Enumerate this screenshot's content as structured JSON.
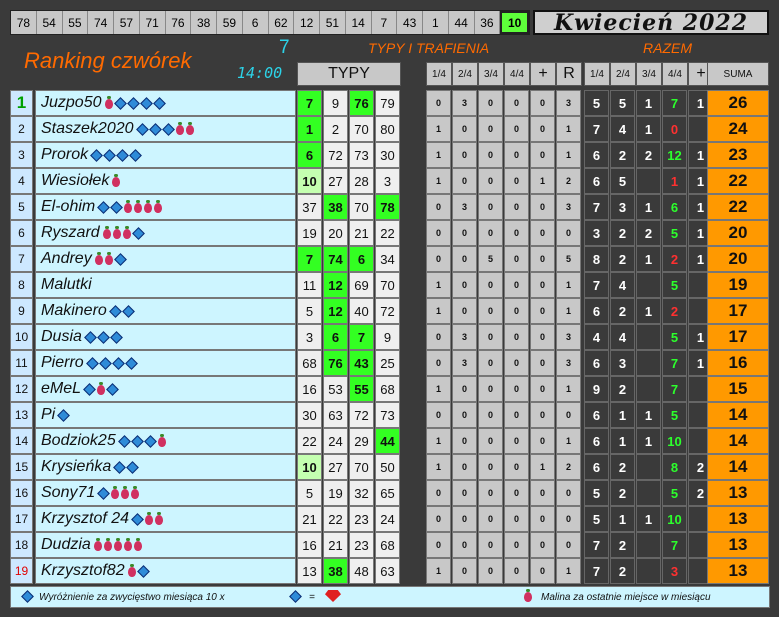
{
  "top_numbers": [
    "78",
    "54",
    "55",
    "74",
    "57",
    "71",
    "76",
    "38",
    "59",
    "6",
    "62",
    "12",
    "51",
    "14",
    "7",
    "43",
    "1",
    "44",
    "36",
    "10"
  ],
  "highlight_number": "10",
  "month_title": "Kwiecień 2022",
  "title": "Ranking czwórek",
  "round": "7",
  "time": "14:00",
  "typy_trafienia": "TYPY I TRAFIENIA",
  "razem": "RAZEM",
  "headers": {
    "typy": "TYPY",
    "score_cols": [
      "1/4",
      "2/4",
      "3/4",
      "4/4",
      "+",
      "R"
    ],
    "razem_cols": [
      "1/4",
      "2/4",
      "3/4",
      "4/4",
      "+"
    ],
    "suma": "SUMA"
  },
  "rows": [
    {
      "rank": "1",
      "name": "Juzpo50",
      "badges": [
        "r",
        "d",
        "d",
        "d",
        "d"
      ],
      "typy": [
        {
          "v": "7",
          "h": 1
        },
        {
          "v": "9",
          "h": 0
        },
        {
          "v": "76",
          "h": 1
        },
        {
          "v": "79",
          "h": 0
        }
      ],
      "sc": [
        "0",
        "3",
        "0",
        "0",
        "0",
        "3"
      ],
      "rz": [
        {
          "v": "5"
        },
        {
          "v": "5"
        },
        {
          "v": "1"
        },
        {
          "v": "7",
          "c": "g"
        },
        {
          "v": "1"
        }
      ],
      "suma": "26"
    },
    {
      "rank": "2",
      "name": "Staszek2020",
      "badges": [
        "d",
        "d",
        "d",
        "r",
        "r"
      ],
      "typy": [
        {
          "v": "1",
          "h": 1
        },
        {
          "v": "2",
          "h": 0
        },
        {
          "v": "70",
          "h": 0
        },
        {
          "v": "80",
          "h": 0
        }
      ],
      "sc": [
        "1",
        "0",
        "0",
        "0",
        "0",
        "1"
      ],
      "rz": [
        {
          "v": "7"
        },
        {
          "v": "4"
        },
        {
          "v": "1"
        },
        {
          "v": "0",
          "c": "r"
        },
        {
          "v": ""
        }
      ],
      "suma": "24"
    },
    {
      "rank": "3",
      "name": "Prorok",
      "badges": [
        "d",
        "d",
        "d",
        "d"
      ],
      "typy": [
        {
          "v": "6",
          "h": 1
        },
        {
          "v": "72",
          "h": 0
        },
        {
          "v": "73",
          "h": 0
        },
        {
          "v": "30",
          "h": 0
        }
      ],
      "sc": [
        "1",
        "0",
        "0",
        "0",
        "0",
        "1"
      ],
      "rz": [
        {
          "v": "6"
        },
        {
          "v": "2"
        },
        {
          "v": "2"
        },
        {
          "v": "12",
          "c": "g"
        },
        {
          "v": "1"
        }
      ],
      "suma": "23"
    },
    {
      "rank": "4",
      "name": "Wiesiołek",
      "badges": [
        "r"
      ],
      "typy": [
        {
          "v": "10",
          "h": 2
        },
        {
          "v": "27",
          "h": 0
        },
        {
          "v": "28",
          "h": 0
        },
        {
          "v": "3",
          "h": 0
        }
      ],
      "sc": [
        "1",
        "0",
        "0",
        "0",
        "1",
        "2"
      ],
      "rz": [
        {
          "v": "6"
        },
        {
          "v": "5"
        },
        {
          "v": ""
        },
        {
          "v": "1",
          "c": "r"
        },
        {
          "v": "1"
        }
      ],
      "suma": "22"
    },
    {
      "rank": "5",
      "name": "El-ohim",
      "badges": [
        "d",
        "d",
        "r",
        "r",
        "r",
        "r"
      ],
      "typy": [
        {
          "v": "37",
          "h": 0
        },
        {
          "v": "38",
          "h": 1
        },
        {
          "v": "70",
          "h": 0
        },
        {
          "v": "78",
          "h": 1
        }
      ],
      "sc": [
        "0",
        "3",
        "0",
        "0",
        "0",
        "3"
      ],
      "rz": [
        {
          "v": "7"
        },
        {
          "v": "3"
        },
        {
          "v": "1"
        },
        {
          "v": "6",
          "c": "g"
        },
        {
          "v": "1"
        }
      ],
      "suma": "22"
    },
    {
      "rank": "6",
      "name": "Ryszard",
      "badges": [
        "r",
        "r",
        "r",
        "d"
      ],
      "typy": [
        {
          "v": "19",
          "h": 0
        },
        {
          "v": "20",
          "h": 0
        },
        {
          "v": "21",
          "h": 0
        },
        {
          "v": "22",
          "h": 0
        }
      ],
      "sc": [
        "0",
        "0",
        "0",
        "0",
        "0",
        "0"
      ],
      "rz": [
        {
          "v": "3"
        },
        {
          "v": "2"
        },
        {
          "v": "2"
        },
        {
          "v": "5",
          "c": "g"
        },
        {
          "v": "1"
        }
      ],
      "suma": "20"
    },
    {
      "rank": "7",
      "name": "Andrey",
      "badges": [
        "r",
        "r",
        "d"
      ],
      "typy": [
        {
          "v": "7",
          "h": 1
        },
        {
          "v": "74",
          "h": 1
        },
        {
          "v": "6",
          "h": 1
        },
        {
          "v": "34",
          "h": 0
        }
      ],
      "sc": [
        "0",
        "0",
        "5",
        "0",
        "0",
        "5"
      ],
      "rz": [
        {
          "v": "8"
        },
        {
          "v": "2"
        },
        {
          "v": "1"
        },
        {
          "v": "2",
          "c": "r"
        },
        {
          "v": "1"
        }
      ],
      "suma": "20"
    },
    {
      "rank": "8",
      "name": "Malutki",
      "badges": [],
      "typy": [
        {
          "v": "11",
          "h": 0
        },
        {
          "v": "12",
          "h": 1
        },
        {
          "v": "69",
          "h": 0
        },
        {
          "v": "70",
          "h": 0
        }
      ],
      "sc": [
        "1",
        "0",
        "0",
        "0",
        "0",
        "1"
      ],
      "rz": [
        {
          "v": "7"
        },
        {
          "v": "4"
        },
        {
          "v": ""
        },
        {
          "v": "5",
          "c": "g"
        },
        {
          "v": ""
        }
      ],
      "suma": "19"
    },
    {
      "rank": "9",
      "name": "Makinero",
      "badges": [
        "d",
        "d"
      ],
      "typy": [
        {
          "v": "5",
          "h": 0
        },
        {
          "v": "12",
          "h": 1
        },
        {
          "v": "40",
          "h": 0
        },
        {
          "v": "72",
          "h": 0
        }
      ],
      "sc": [
        "1",
        "0",
        "0",
        "0",
        "0",
        "1"
      ],
      "rz": [
        {
          "v": "6"
        },
        {
          "v": "2"
        },
        {
          "v": "1"
        },
        {
          "v": "2",
          "c": "r"
        },
        {
          "v": ""
        }
      ],
      "suma": "17"
    },
    {
      "rank": "10",
      "name": "Dusia",
      "badges": [
        "d",
        "d",
        "d"
      ],
      "typy": [
        {
          "v": "3",
          "h": 0
        },
        {
          "v": "6",
          "h": 1
        },
        {
          "v": "7",
          "h": 1
        },
        {
          "v": "9",
          "h": 0
        }
      ],
      "sc": [
        "0",
        "3",
        "0",
        "0",
        "0",
        "3"
      ],
      "rz": [
        {
          "v": "4"
        },
        {
          "v": "4"
        },
        {
          "v": ""
        },
        {
          "v": "5",
          "c": "g"
        },
        {
          "v": "1"
        }
      ],
      "suma": "17"
    },
    {
      "rank": "11",
      "name": "Pierro",
      "badges": [
        "d",
        "d",
        "d",
        "d"
      ],
      "typy": [
        {
          "v": "68",
          "h": 0
        },
        {
          "v": "76",
          "h": 1
        },
        {
          "v": "43",
          "h": 1
        },
        {
          "v": "25",
          "h": 0
        }
      ],
      "sc": [
        "0",
        "3",
        "0",
        "0",
        "0",
        "3"
      ],
      "rz": [
        {
          "v": "6"
        },
        {
          "v": "3"
        },
        {
          "v": ""
        },
        {
          "v": "7",
          "c": "g"
        },
        {
          "v": "1"
        }
      ],
      "suma": "16"
    },
    {
      "rank": "12",
      "name": "eMeL",
      "badges": [
        "d",
        "r",
        "d"
      ],
      "typy": [
        {
          "v": "16",
          "h": 0
        },
        {
          "v": "53",
          "h": 0
        },
        {
          "v": "55",
          "h": 1
        },
        {
          "v": "68",
          "h": 0
        }
      ],
      "sc": [
        "1",
        "0",
        "0",
        "0",
        "0",
        "1"
      ],
      "rz": [
        {
          "v": "9"
        },
        {
          "v": "2"
        },
        {
          "v": ""
        },
        {
          "v": "7",
          "c": "g"
        },
        {
          "v": ""
        }
      ],
      "suma": "15"
    },
    {
      "rank": "13",
      "name": "Pi",
      "badges": [
        "d"
      ],
      "typy": [
        {
          "v": "30",
          "h": 0
        },
        {
          "v": "63",
          "h": 0
        },
        {
          "v": "72",
          "h": 0
        },
        {
          "v": "73",
          "h": 0
        }
      ],
      "sc": [
        "0",
        "0",
        "0",
        "0",
        "0",
        "0"
      ],
      "rz": [
        {
          "v": "6"
        },
        {
          "v": "1"
        },
        {
          "v": "1"
        },
        {
          "v": "5",
          "c": "g"
        },
        {
          "v": ""
        }
      ],
      "suma": "14"
    },
    {
      "rank": "14",
      "name": "Bodziok25",
      "badges": [
        "d",
        "d",
        "d",
        "r"
      ],
      "typy": [
        {
          "v": "22",
          "h": 0
        },
        {
          "v": "24",
          "h": 0
        },
        {
          "v": "29",
          "h": 0
        },
        {
          "v": "44",
          "h": 1
        }
      ],
      "sc": [
        "1",
        "0",
        "0",
        "0",
        "0",
        "1"
      ],
      "rz": [
        {
          "v": "6"
        },
        {
          "v": "1"
        },
        {
          "v": "1"
        },
        {
          "v": "10",
          "c": "g"
        },
        {
          "v": ""
        }
      ],
      "suma": "14"
    },
    {
      "rank": "15",
      "name": "Krysieńka",
      "badges": [
        "d",
        "d"
      ],
      "typy": [
        {
          "v": "10",
          "h": 2
        },
        {
          "v": "27",
          "h": 0
        },
        {
          "v": "70",
          "h": 0
        },
        {
          "v": "50",
          "h": 0
        }
      ],
      "sc": [
        "1",
        "0",
        "0",
        "0",
        "1",
        "2"
      ],
      "rz": [
        {
          "v": "6"
        },
        {
          "v": "2"
        },
        {
          "v": ""
        },
        {
          "v": "8",
          "c": "g"
        },
        {
          "v": "2"
        }
      ],
      "suma": "14"
    },
    {
      "rank": "16",
      "name": "Sony71",
      "badges": [
        "d",
        "r",
        "r",
        "r"
      ],
      "typy": [
        {
          "v": "5",
          "h": 0
        },
        {
          "v": "19",
          "h": 0
        },
        {
          "v": "32",
          "h": 0
        },
        {
          "v": "65",
          "h": 0
        }
      ],
      "sc": [
        "0",
        "0",
        "0",
        "0",
        "0",
        "0"
      ],
      "rz": [
        {
          "v": "5"
        },
        {
          "v": "2"
        },
        {
          "v": ""
        },
        {
          "v": "5",
          "c": "g"
        },
        {
          "v": "2"
        }
      ],
      "suma": "13"
    },
    {
      "rank": "17",
      "name": "Krzysztof 24",
      "badges": [
        "d",
        "r",
        "r"
      ],
      "typy": [
        {
          "v": "21",
          "h": 0
        },
        {
          "v": "22",
          "h": 0
        },
        {
          "v": "23",
          "h": 0
        },
        {
          "v": "24",
          "h": 0
        }
      ],
      "sc": [
        "0",
        "0",
        "0",
        "0",
        "0",
        "0"
      ],
      "rz": [
        {
          "v": "5"
        },
        {
          "v": "1"
        },
        {
          "v": "1"
        },
        {
          "v": "10",
          "c": "g"
        },
        {
          "v": ""
        }
      ],
      "suma": "13"
    },
    {
      "rank": "18",
      "name": "Dudzia",
      "badges": [
        "r",
        "r",
        "r",
        "r",
        "r"
      ],
      "typy": [
        {
          "v": "16",
          "h": 0
        },
        {
          "v": "21",
          "h": 0
        },
        {
          "v": "23",
          "h": 0
        },
        {
          "v": "68",
          "h": 0
        }
      ],
      "sc": [
        "0",
        "0",
        "0",
        "0",
        "0",
        "0"
      ],
      "rz": [
        {
          "v": "7"
        },
        {
          "v": "2"
        },
        {
          "v": ""
        },
        {
          "v": "7",
          "c": "g"
        },
        {
          "v": ""
        }
      ],
      "suma": "13"
    },
    {
      "rank": "19",
      "name": "Krzysztof82",
      "badges": [
        "r",
        "d"
      ],
      "typy": [
        {
          "v": "13",
          "h": 0
        },
        {
          "v": "38",
          "h": 1
        },
        {
          "v": "48",
          "h": 0
        },
        {
          "v": "63",
          "h": 0
        }
      ],
      "sc": [
        "1",
        "0",
        "0",
        "0",
        "0",
        "1"
      ],
      "rz": [
        {
          "v": "7"
        },
        {
          "v": "2"
        },
        {
          "v": ""
        },
        {
          "v": "3",
          "c": "r"
        },
        {
          "v": ""
        }
      ],
      "suma": "13"
    }
  ],
  "footer": {
    "left": "Wyróżnienie za zwycięstwo miesiąca 10 x",
    "equals": "=",
    "right": "Malina za ostatnie miejsce w miesiącu"
  }
}
